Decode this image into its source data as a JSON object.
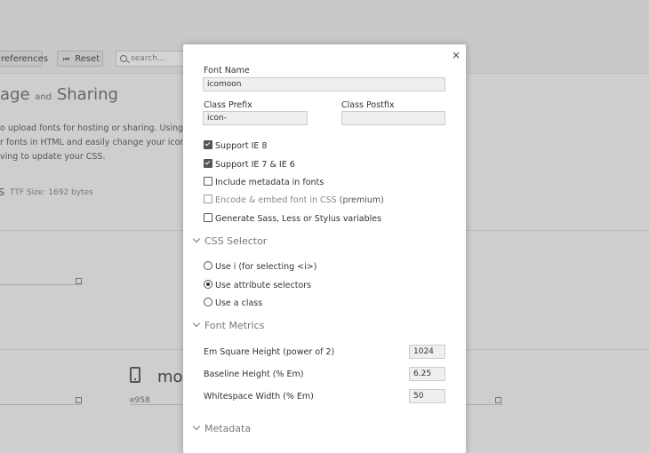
{
  "background": {
    "toolbar": {
      "preferences_label": "references",
      "reset_label": "Reset",
      "search_placeholder": "search..."
    },
    "heading": {
      "left": "age",
      "mid": "and",
      "right": "Sharing"
    },
    "paragraph_lines": [
      "o upload fonts for hosting or sharing. Using this fea",
      "r fonts in HTML and easily change your icon selecti",
      "ving to update your CSS."
    ],
    "ttf_size": "TTF Size: 1692 bytes",
    "glyph_char": "s",
    "icon_name": "mob",
    "icon_code": "e958"
  },
  "modal": {
    "close_label": "×",
    "font_name": {
      "label": "Font Name",
      "value": "icomoon"
    },
    "class_prefix": {
      "label": "Class Prefix",
      "value": "icon-"
    },
    "class_postfix": {
      "label": "Class Postfix",
      "value": ""
    },
    "options": [
      {
        "label": "Support IE 8",
        "checked": true
      },
      {
        "label": "Support IE 7 & IE 6",
        "checked": true
      },
      {
        "label": "Include metadata in fonts",
        "checked": false
      },
      {
        "label": "Encode & embed font in CSS",
        "note": "(premium)",
        "checked": false,
        "disabled": true
      },
      {
        "label": "Generate Sass, Less or Stylus variables",
        "checked": false
      }
    ],
    "css_selector": {
      "title": "CSS Selector",
      "choices": [
        {
          "label": "Use i (for selecting <i>)",
          "selected": false
        },
        {
          "label": "Use attribute selectors",
          "selected": true
        },
        {
          "label": "Use a class",
          "selected": false
        }
      ]
    },
    "font_metrics": {
      "title": "Font Metrics",
      "em_square": {
        "label": "Em Square Height (power of 2)",
        "value": "1024"
      },
      "baseline": {
        "label": "Baseline Height (% Em)",
        "value": "6.25"
      },
      "whitespace": {
        "label": "Whitespace Width (% Em)",
        "value": "50"
      }
    },
    "metadata": {
      "title": "Metadata"
    }
  }
}
